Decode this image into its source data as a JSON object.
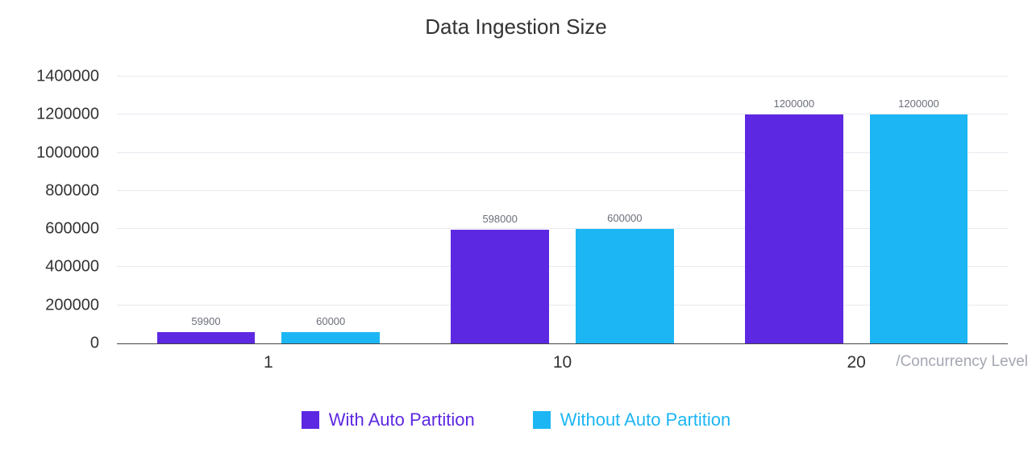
{
  "chart_data": {
    "type": "bar",
    "title": "Data Ingestion Size",
    "xlabel": "/Concurrency Level",
    "ylabel": "",
    "categories": [
      "1",
      "10",
      "20"
    ],
    "series": [
      {
        "name": "With Auto Partition",
        "color": "#5d28e2",
        "values": [
          59900,
          598000,
          1200000
        ]
      },
      {
        "name": "Without Auto Partition",
        "color": "#1cb6f4",
        "values": [
          60000,
          600000,
          1200000
        ]
      }
    ],
    "ylim": [
      0,
      1400000
    ],
    "yticks": [
      0,
      200000,
      400000,
      600000,
      800000,
      1000000,
      1200000,
      1400000
    ],
    "grid": true,
    "legend_position": "bottom"
  },
  "layout": {
    "bar_width_pct": 11,
    "group_gap_pct": 3.0,
    "group_centers_pct": [
      17,
      50,
      83
    ]
  }
}
